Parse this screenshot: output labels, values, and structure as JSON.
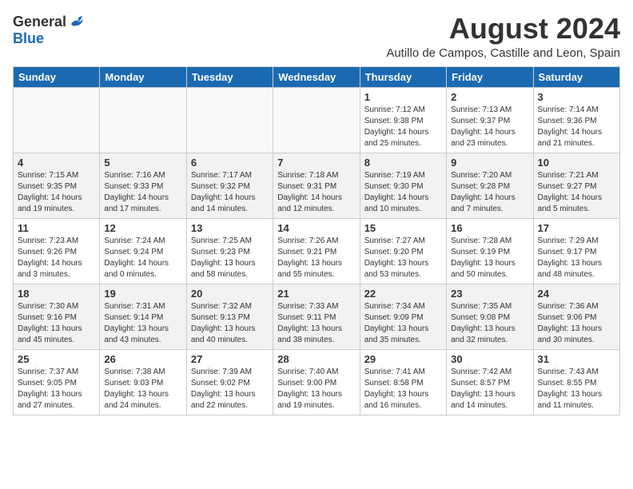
{
  "logo": {
    "general": "General",
    "blue": "Blue"
  },
  "title": {
    "month_year": "August 2024",
    "location": "Autillo de Campos, Castille and Leon, Spain"
  },
  "weekdays": [
    "Sunday",
    "Monday",
    "Tuesday",
    "Wednesday",
    "Thursday",
    "Friday",
    "Saturday"
  ],
  "weeks": [
    [
      {
        "day": "",
        "info": ""
      },
      {
        "day": "",
        "info": ""
      },
      {
        "day": "",
        "info": ""
      },
      {
        "day": "",
        "info": ""
      },
      {
        "day": "1",
        "info": "Sunrise: 7:12 AM\nSunset: 9:38 PM\nDaylight: 14 hours\nand 25 minutes."
      },
      {
        "day": "2",
        "info": "Sunrise: 7:13 AM\nSunset: 9:37 PM\nDaylight: 14 hours\nand 23 minutes."
      },
      {
        "day": "3",
        "info": "Sunrise: 7:14 AM\nSunset: 9:36 PM\nDaylight: 14 hours\nand 21 minutes."
      }
    ],
    [
      {
        "day": "4",
        "info": "Sunrise: 7:15 AM\nSunset: 9:35 PM\nDaylight: 14 hours\nand 19 minutes."
      },
      {
        "day": "5",
        "info": "Sunrise: 7:16 AM\nSunset: 9:33 PM\nDaylight: 14 hours\nand 17 minutes."
      },
      {
        "day": "6",
        "info": "Sunrise: 7:17 AM\nSunset: 9:32 PM\nDaylight: 14 hours\nand 14 minutes."
      },
      {
        "day": "7",
        "info": "Sunrise: 7:18 AM\nSunset: 9:31 PM\nDaylight: 14 hours\nand 12 minutes."
      },
      {
        "day": "8",
        "info": "Sunrise: 7:19 AM\nSunset: 9:30 PM\nDaylight: 14 hours\nand 10 minutes."
      },
      {
        "day": "9",
        "info": "Sunrise: 7:20 AM\nSunset: 9:28 PM\nDaylight: 14 hours\nand 7 minutes."
      },
      {
        "day": "10",
        "info": "Sunrise: 7:21 AM\nSunset: 9:27 PM\nDaylight: 14 hours\nand 5 minutes."
      }
    ],
    [
      {
        "day": "11",
        "info": "Sunrise: 7:23 AM\nSunset: 9:26 PM\nDaylight: 14 hours\nand 3 minutes."
      },
      {
        "day": "12",
        "info": "Sunrise: 7:24 AM\nSunset: 9:24 PM\nDaylight: 14 hours\nand 0 minutes."
      },
      {
        "day": "13",
        "info": "Sunrise: 7:25 AM\nSunset: 9:23 PM\nDaylight: 13 hours\nand 58 minutes."
      },
      {
        "day": "14",
        "info": "Sunrise: 7:26 AM\nSunset: 9:21 PM\nDaylight: 13 hours\nand 55 minutes."
      },
      {
        "day": "15",
        "info": "Sunrise: 7:27 AM\nSunset: 9:20 PM\nDaylight: 13 hours\nand 53 minutes."
      },
      {
        "day": "16",
        "info": "Sunrise: 7:28 AM\nSunset: 9:19 PM\nDaylight: 13 hours\nand 50 minutes."
      },
      {
        "day": "17",
        "info": "Sunrise: 7:29 AM\nSunset: 9:17 PM\nDaylight: 13 hours\nand 48 minutes."
      }
    ],
    [
      {
        "day": "18",
        "info": "Sunrise: 7:30 AM\nSunset: 9:16 PM\nDaylight: 13 hours\nand 45 minutes."
      },
      {
        "day": "19",
        "info": "Sunrise: 7:31 AM\nSunset: 9:14 PM\nDaylight: 13 hours\nand 43 minutes."
      },
      {
        "day": "20",
        "info": "Sunrise: 7:32 AM\nSunset: 9:13 PM\nDaylight: 13 hours\nand 40 minutes."
      },
      {
        "day": "21",
        "info": "Sunrise: 7:33 AM\nSunset: 9:11 PM\nDaylight: 13 hours\nand 38 minutes."
      },
      {
        "day": "22",
        "info": "Sunrise: 7:34 AM\nSunset: 9:09 PM\nDaylight: 13 hours\nand 35 minutes."
      },
      {
        "day": "23",
        "info": "Sunrise: 7:35 AM\nSunset: 9:08 PM\nDaylight: 13 hours\nand 32 minutes."
      },
      {
        "day": "24",
        "info": "Sunrise: 7:36 AM\nSunset: 9:06 PM\nDaylight: 13 hours\nand 30 minutes."
      }
    ],
    [
      {
        "day": "25",
        "info": "Sunrise: 7:37 AM\nSunset: 9:05 PM\nDaylight: 13 hours\nand 27 minutes."
      },
      {
        "day": "26",
        "info": "Sunrise: 7:38 AM\nSunset: 9:03 PM\nDaylight: 13 hours\nand 24 minutes."
      },
      {
        "day": "27",
        "info": "Sunrise: 7:39 AM\nSunset: 9:02 PM\nDaylight: 13 hours\nand 22 minutes."
      },
      {
        "day": "28",
        "info": "Sunrise: 7:40 AM\nSunset: 9:00 PM\nDaylight: 13 hours\nand 19 minutes."
      },
      {
        "day": "29",
        "info": "Sunrise: 7:41 AM\nSunset: 8:58 PM\nDaylight: 13 hours\nand 16 minutes."
      },
      {
        "day": "30",
        "info": "Sunrise: 7:42 AM\nSunset: 8:57 PM\nDaylight: 13 hours\nand 14 minutes."
      },
      {
        "day": "31",
        "info": "Sunrise: 7:43 AM\nSunset: 8:55 PM\nDaylight: 13 hours\nand 11 minutes."
      }
    ]
  ]
}
